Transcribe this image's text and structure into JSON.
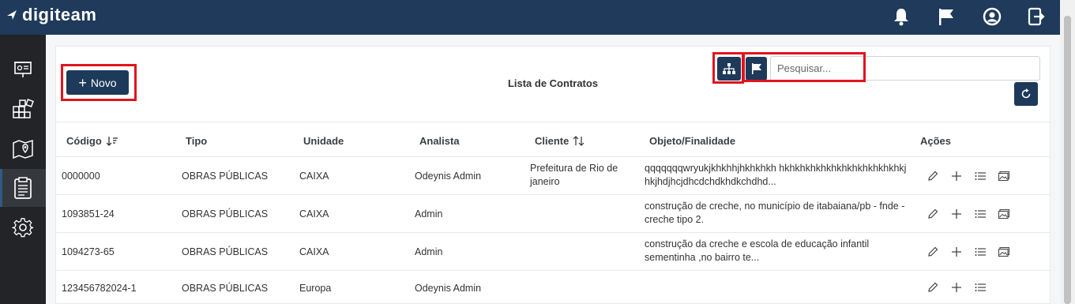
{
  "app": {
    "name": "digiteam"
  },
  "topbar": {
    "icons": [
      "bell-icon",
      "flag-icon",
      "user-circle-icon",
      "logout-icon"
    ]
  },
  "sidebar": {
    "items": [
      {
        "icon": "presentation-board-icon"
      },
      {
        "icon": "grid-blocks-icon"
      },
      {
        "icon": "map-pin-icon"
      },
      {
        "icon": "clipboard-list-icon",
        "active": true
      },
      {
        "icon": "gear-icon"
      }
    ]
  },
  "toolbar": {
    "new_label": "Novo",
    "title": "Lista de Contratos",
    "search_placeholder": "Pesquisar...",
    "icons": [
      "hierarchy-icon",
      "flag-icon",
      "refresh-icon"
    ]
  },
  "table": {
    "columns": [
      "Código",
      "Tipo",
      "Unidade",
      "Analista",
      "Cliente",
      "Objeto/Finalidade",
      "Ações"
    ],
    "rows": [
      {
        "codigo": "0000000",
        "tipo": "OBRAS PÚBLICAS",
        "unidade": "CAIXA",
        "analista": "Odeynis Admin",
        "cliente": "Prefeitura de Rio de janeiro",
        "objeto": "qqqqqqqwryukjkhkhhjhkhkhkh hkhkhkhkhkhkhkhkhkhkhkhkjhkjhdjhcjdhcdchdkhdkchdhd..."
      },
      {
        "codigo": "1093851-24",
        "tipo": "OBRAS PÚBLICAS",
        "unidade": "CAIXA",
        "analista": "Admin",
        "cliente": "",
        "objeto": "construção de creche, no município de itabaiana/pb - fnde - creche tipo 2."
      },
      {
        "codigo": "1094273-65",
        "tipo": "OBRAS PÚBLICAS",
        "unidade": "CAIXA",
        "analista": "Admin",
        "cliente": "",
        "objeto": "construção da creche e escola de educação infantil sementinha ,no bairro te..."
      },
      {
        "codigo": "123456782024-1",
        "tipo": "OBRAS PÚBLICAS",
        "unidade": "Europa",
        "analista": "Odeynis Admin",
        "cliente": "",
        "objeto": ""
      }
    ],
    "row_actions": [
      "edit-pencil-icon",
      "add-plus-icon",
      "list-icon",
      "image-icon"
    ]
  },
  "colors": {
    "topbar": "#1f3a5a",
    "sidebar": "#222427",
    "primary_button": "#1e3a5a",
    "highlight": "#e0141e"
  }
}
